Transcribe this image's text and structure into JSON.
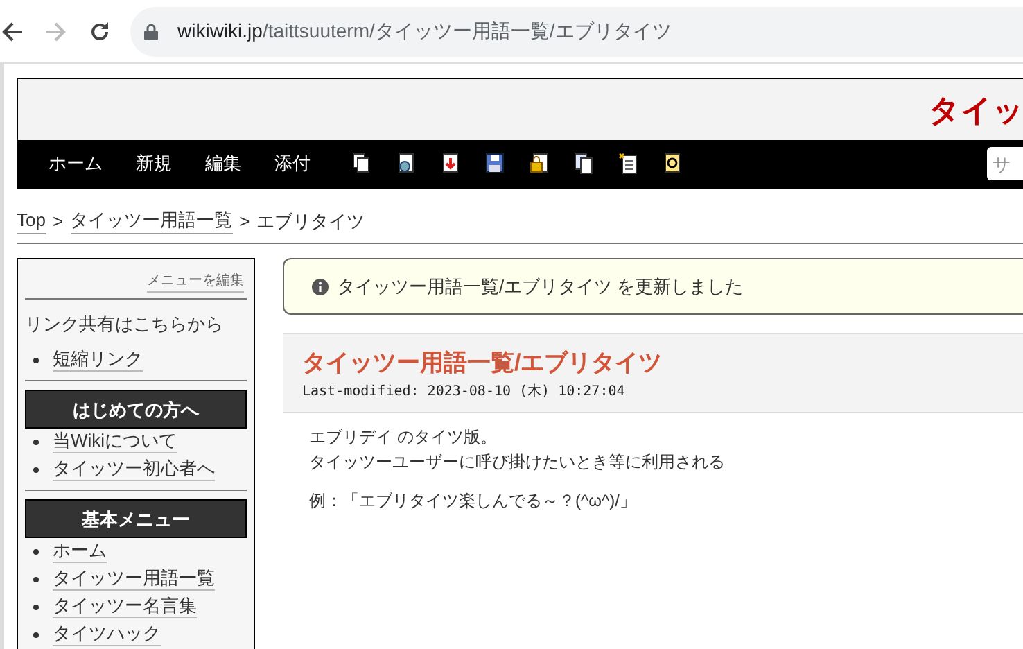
{
  "browser": {
    "url_host": "wikiwiki.jp",
    "url_path": "/taittsuuterm/タイッツー用語一覧/エブリタイツ"
  },
  "site": {
    "title": "タイッ",
    "nav": [
      "ホーム",
      "新規",
      "編集",
      "添付"
    ],
    "tools": [
      {
        "kind": "copy"
      },
      {
        "kind": "diff"
      },
      {
        "kind": "download"
      },
      {
        "kind": "save"
      },
      {
        "kind": "lock"
      },
      {
        "kind": "list"
      },
      {
        "kind": "new"
      },
      {
        "kind": "help"
      }
    ],
    "search": {
      "placeholder": "サ"
    }
  },
  "breadcrumb": [
    {
      "kind": "link",
      "text": "Top"
    },
    {
      "kind": "separator",
      "text": ">"
    },
    {
      "kind": "link",
      "text": "タイッツー用語一覧"
    },
    {
      "kind": "separator",
      "text": ">"
    },
    {
      "kind": "current",
      "text": "エブリタイツ"
    }
  ],
  "sidebar": {
    "edit_link": "メニューを編集",
    "share_text": "リンク共有はこちらから",
    "sections": [
      {
        "items": [
          "短縮リンク"
        ]
      },
      {
        "heading": "はじめての方へ",
        "items": [
          "当Wikiについて",
          "タイッツー初心者へ"
        ]
      },
      {
        "heading": "基本メニュー",
        "items": [
          "ホーム",
          "タイッツー用語一覧",
          "タイッツー名言集",
          "タイツハック"
        ]
      }
    ]
  },
  "notice": {
    "page": "タイッツー用語一覧/エブリタイツ",
    "message": "を更新しました"
  },
  "page": {
    "title": "タイッツー用語一覧/エブリタイツ",
    "last_modified": "Last-modified: 2023-08-10 (木) 10:27:04",
    "lines": [
      "エブリデイ のタイツ版。",
      "タイッツーユーザーに呼び掛けたいとき等に利用される"
    ],
    "example": "例：「エブリタイツ楽しんでる～？(^ω^)/」"
  }
}
